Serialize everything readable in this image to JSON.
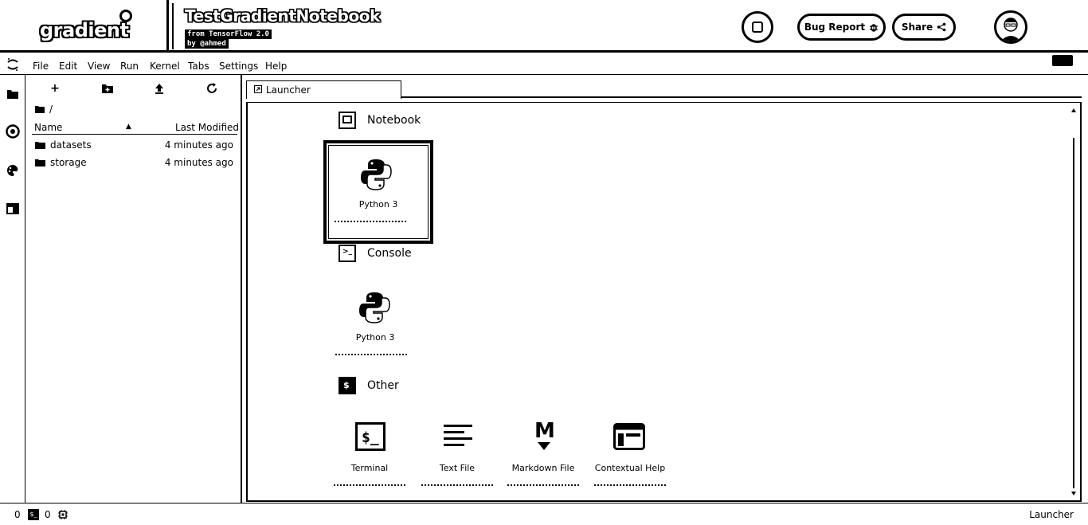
{
  "header": {
    "logo": "gradient",
    "notebook_title": "TestGradientNotebook",
    "subtitle_line1": "from TensorFlow 2.0",
    "subtitle_line2": "by @ahmed",
    "bug_report_label": "Bug Report",
    "share_label": "Share"
  },
  "menu": [
    "File",
    "Edit",
    "View",
    "Run",
    "Kernel",
    "Tabs",
    "Settings",
    "Help"
  ],
  "file_browser": {
    "path": "/",
    "col_name": "Name",
    "col_modified": "Last Modified",
    "rows": [
      {
        "name": "datasets",
        "modified": "4 minutes ago"
      },
      {
        "name": "storage",
        "modified": "4 minutes ago"
      }
    ]
  },
  "launcher": {
    "tab_label": "Launcher",
    "sections": {
      "notebook": "Notebook",
      "console": "Console",
      "other": "Other"
    },
    "notebook_cards": [
      {
        "label": "Python 3"
      }
    ],
    "console_cards": [
      {
        "label": "Python 3"
      }
    ],
    "other_cards": [
      {
        "label": "Terminal"
      },
      {
        "label": "Text File"
      },
      {
        "label": "Markdown File"
      },
      {
        "label": "Contextual Help"
      }
    ]
  },
  "status": {
    "left_count_1": "0",
    "left_count_2": "0",
    "right_label": "Launcher"
  }
}
